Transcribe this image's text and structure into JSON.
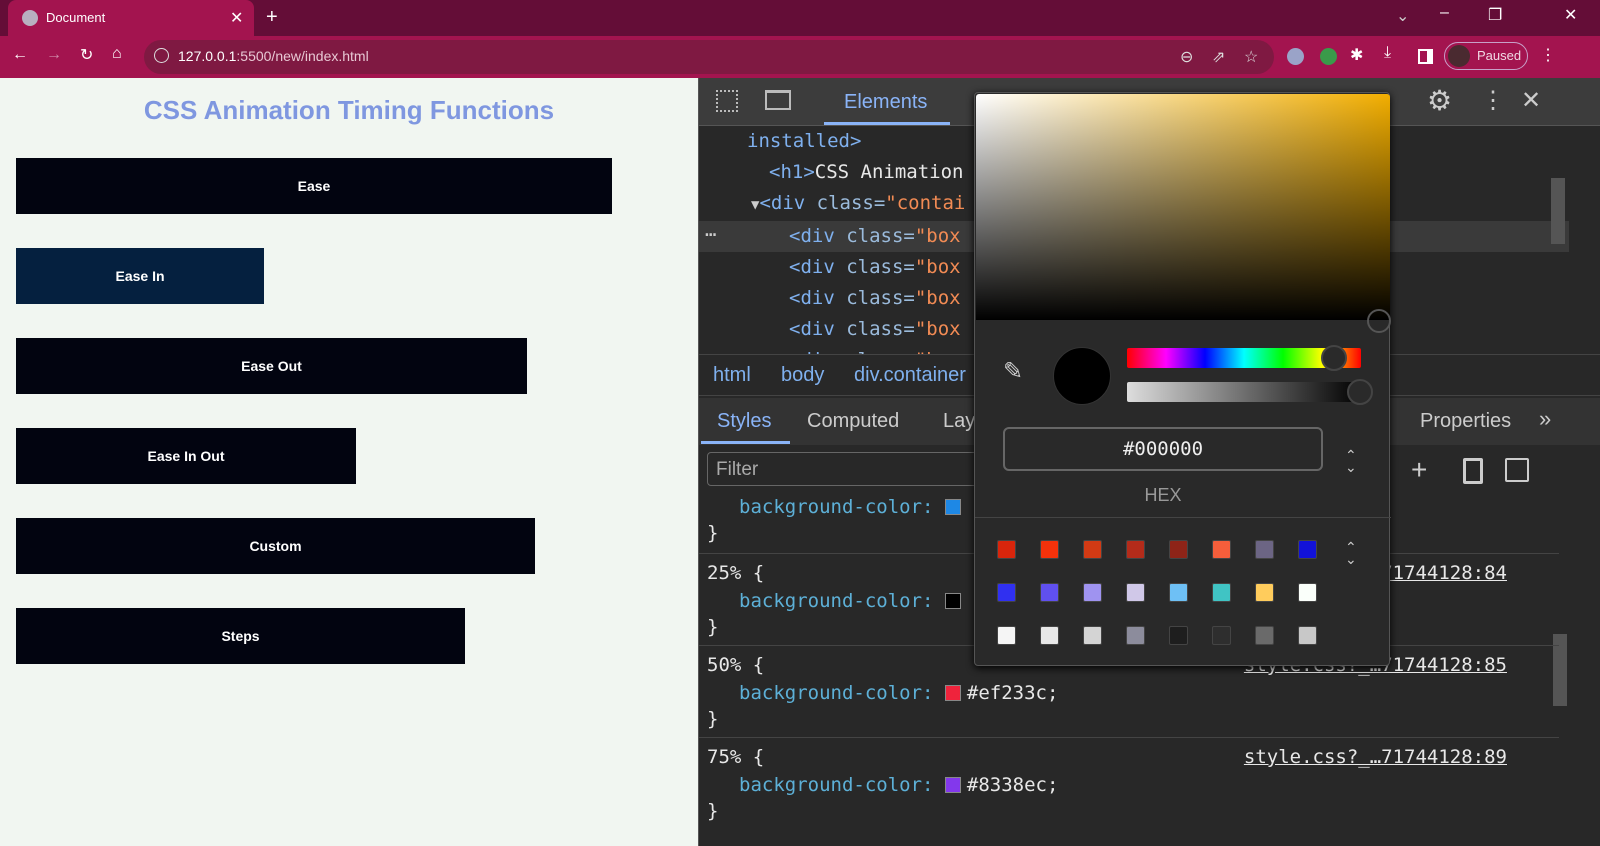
{
  "browser": {
    "tab_title": "Document",
    "url_host": "127.0.0.1",
    "url_rest": ":5500/new/index.html",
    "profile_label": "Paused"
  },
  "page": {
    "title": "CSS Animation Timing Functions",
    "boxes": [
      "Ease",
      "Ease In",
      "Ease Out",
      "Ease In Out",
      "Custom",
      "Steps"
    ]
  },
  "devtools": {
    "tabs": {
      "elements": "Elements"
    },
    "dom": {
      "line0": "installed>",
      "line1_tag": "<h1>",
      "line1_text": "CSS Animation",
      "line2_tag": "<div ",
      "line2_attr": "class=",
      "line2_val": "\"contai",
      "box_tag": "<div ",
      "box_attr": "class=",
      "box_val": "\"box"
    },
    "breadcrumb": [
      "html",
      "body",
      "div.container"
    ],
    "style_tabs": [
      "Styles",
      "Computed",
      "Lay",
      "Properties"
    ],
    "filter_placeholder": "Filter",
    "rules": [
      {
        "selector": "",
        "prop": "background-color:",
        "value": "",
        "color": "#1e88e5",
        "source": ""
      },
      {
        "selector": "25% {",
        "prop": "background-color:",
        "value": "",
        "color": "#000000",
        "source": "?_…71744128:84"
      },
      {
        "selector": "50% {",
        "prop": "background-color:",
        "value": "#ef233c;",
        "color": "#ef233c",
        "source": "style.css?_…71744128:85"
      },
      {
        "selector": "75% {",
        "prop": "background-color:",
        "value": "#8338ec;",
        "color": "#8338ec",
        "source": "style.css?_…71744128:89"
      }
    ],
    "close_brace": "}"
  },
  "picker": {
    "hex": "#000000",
    "format": "HEX",
    "palette": [
      "#d8250c",
      "#f4320b",
      "#d23a14",
      "#b42b1a",
      "#8e2418",
      "#f55e3b",
      "#6c6584",
      "#1212d8",
      "#3030f0",
      "#6050ef",
      "#9f93f0",
      "#d0c8e8",
      "#6ec0f5",
      "#40c4c4",
      "#ffcc5c",
      "#fafffa",
      "#f5f5f5",
      "#e8e8e8",
      "#d4d4d4",
      "#8c8c9c",
      "#1e1e1e",
      "#2e2e2e",
      "#6a6a6a",
      "#c8c8c8"
    ]
  }
}
